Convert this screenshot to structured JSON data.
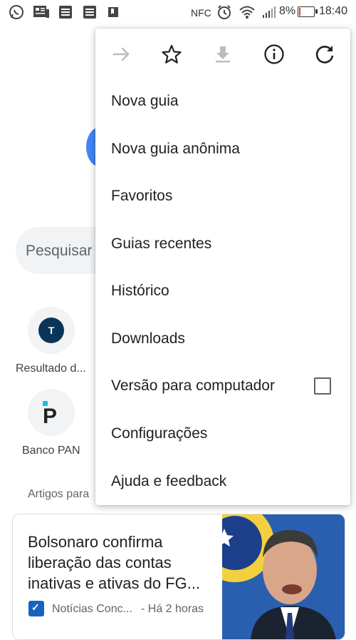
{
  "status_bar": {
    "left_icons": [
      "whatsapp-icon",
      "news-icon",
      "doc-icon",
      "doc-icon",
      "bookmark-icon"
    ],
    "nfc": "NFC",
    "battery": "8%",
    "battery_level": 0.08,
    "time": "18:40"
  },
  "page": {
    "search_placeholder": "Pesquisar",
    "shortcuts": [
      {
        "label": "Resultado d...",
        "icon": "T"
      },
      {
        "label": "Banco PAN",
        "icon": "P"
      }
    ],
    "section_label": "Artigos para",
    "article": {
      "title": "Bolsonaro confirma liberação das contas inativas e ativas do FG...",
      "source": "Notícias Conc...",
      "time": "- Há 2 horas"
    }
  },
  "menu": {
    "toolbar": [
      "forward-icon",
      "bookmark-star-icon",
      "download-icon",
      "info-icon",
      "refresh-icon"
    ],
    "items": [
      {
        "label": "Nova guia"
      },
      {
        "label": "Nova guia anônima"
      },
      {
        "label": "Favoritos"
      },
      {
        "label": "Guias recentes"
      },
      {
        "label": "Histórico"
      },
      {
        "label": "Downloads"
      },
      {
        "label": "Versão para computador",
        "checkbox": false
      },
      {
        "label": "Configurações"
      },
      {
        "label": "Ajuda e feedback"
      }
    ]
  },
  "colors": {
    "google_blue": "#4285f4",
    "menu_text": "#202124",
    "disabled_icon": "#bdbdbd",
    "battery_low": "#e53935"
  }
}
